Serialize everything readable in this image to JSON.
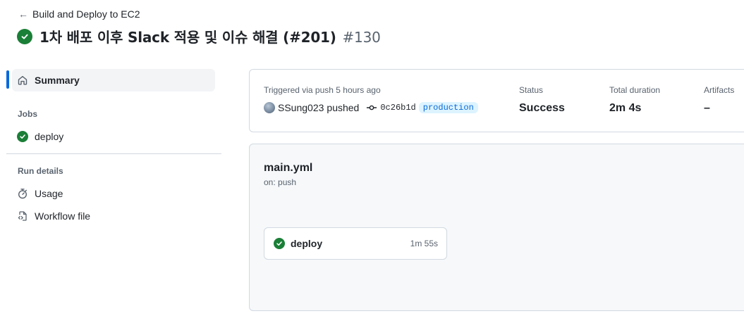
{
  "header": {
    "back_label": "Build and Deploy to EC2",
    "run_title": "1차 배포 이후 Slack 적용 및 이슈 해결 (#201)",
    "run_number": "#130"
  },
  "sidebar": {
    "summary_label": "Summary",
    "jobs_heading": "Jobs",
    "jobs": [
      {
        "label": "deploy",
        "status": "success"
      }
    ],
    "run_details_heading": "Run details",
    "usage_label": "Usage",
    "workflow_file_label": "Workflow file"
  },
  "summary": {
    "trigger_text": "Triggered via push 5 hours ago",
    "actor": "SSung023",
    "action": "pushed",
    "commit_sha": "0c26b1d",
    "branch": "production",
    "status_label": "Status",
    "status_value": "Success",
    "duration_label": "Total duration",
    "duration_value": "2m 4s",
    "artifacts_label": "Artifacts",
    "artifacts_value": "–"
  },
  "graph": {
    "workflow_file": "main.yml",
    "trigger": "on: push",
    "job": {
      "name": "deploy",
      "duration": "1m 55s"
    }
  },
  "colors": {
    "success": "#1a7f37",
    "accent": "#0969da",
    "branch_bg": "#ddf4ff",
    "border": "#d1d9e0",
    "muted": "#59636e"
  },
  "icons": {
    "back": "arrow-left-icon",
    "status": "check-circle-fill-icon",
    "summary": "home-icon",
    "usage": "stopwatch-icon",
    "workflow_file": "file-code-icon",
    "commit": "git-commit-icon"
  }
}
